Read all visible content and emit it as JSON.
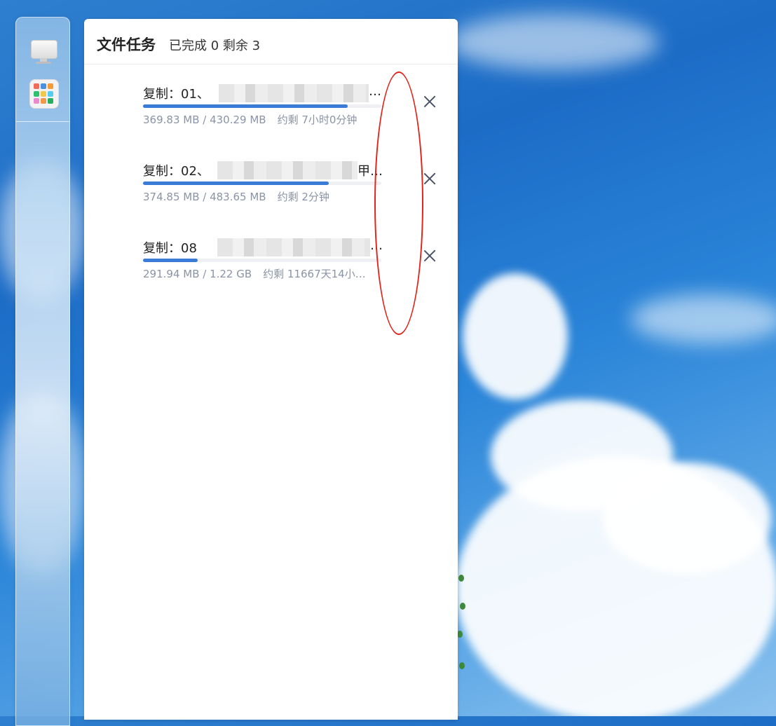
{
  "panel": {
    "title": "文件任务",
    "summary": "已完成 0 剩余 3"
  },
  "tasks": [
    {
      "name": "复制：01、",
      "name_tail": "…",
      "progress_text": "369.83 MB / 430.29 MB",
      "eta": "约剩 7小时0分钟",
      "progress": 0.86
    },
    {
      "name": "复制：02、",
      "name_tail": "甲…",
      "progress_text": "374.85 MB / 483.65 MB",
      "eta": "约剩 2分钟",
      "progress": 0.78
    },
    {
      "name": "复制：08",
      "name_tail": "…",
      "progress_text": "291.94 MB / 1.22 GB",
      "eta": "约剩 11667天14小…",
      "progress": 0.23
    }
  ],
  "dock": {
    "icons": [
      "monitor-icon",
      "apps-icon"
    ]
  },
  "colors": {
    "accent": "#3b7bd8",
    "annotation": "#e0241b"
  }
}
